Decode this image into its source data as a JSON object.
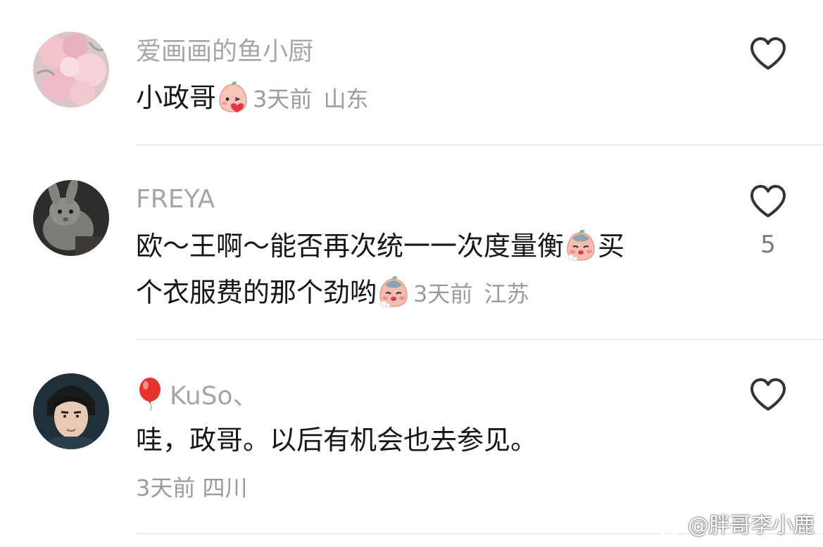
{
  "comments": [
    {
      "username": "爱画画的鱼小厨",
      "text_line1": "小政哥",
      "emoji1": "kiss-emoji",
      "time": "3天前",
      "location": "山东",
      "avatar": "peach-blossom-avatar",
      "like_icon": "heart-outline-icon"
    },
    {
      "username": "FREYA",
      "text_line1": "欧～王啊～能否再次统一一次度量衡",
      "emoji1": "blush-emoji",
      "text_line1_tail": "买",
      "text_line2": "个衣服费的那个劲哟",
      "emoji2": "blush-emoji",
      "time": "3天前",
      "location": "江苏",
      "like_count": "5",
      "avatar": "rabbit-avatar",
      "like_icon": "heart-outline-icon"
    },
    {
      "username": "KuSo、",
      "username_prefix_icon": "balloon-icon",
      "text_line1": "哇，政哥。以后有机会也去参见。",
      "time": "3天前",
      "location": "四川",
      "avatar": "man-portrait-avatar",
      "like_icon": "heart-outline-icon"
    }
  ],
  "watermark": "@胖哥李小鹿",
  "colors": {
    "username": "#a6a6a6",
    "text": "#161616",
    "meta": "#9b9b9b",
    "divider": "#ececec",
    "heart": "#333333"
  }
}
